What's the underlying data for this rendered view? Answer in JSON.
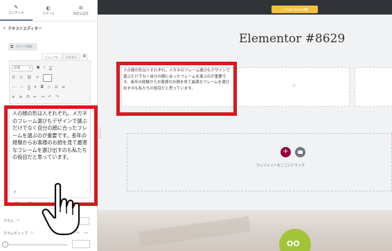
{
  "panel": {
    "tabs": [
      {
        "icon": "✎",
        "label": "コンテンツ"
      },
      {
        "icon": "◐",
        "label": "スタイル"
      },
      {
        "icon": "✲",
        "label": "高度な設定"
      }
    ],
    "section_title": "テキストエディター",
    "media_button": "メディアを追加",
    "editor_tabs": [
      "ビジュアル",
      "テキスト"
    ],
    "format_select": "段落",
    "toolbar_row1": [
      "B",
      "I",
      "U"
    ],
    "toolbar_row2": [
      "☰",
      "☷",
      "⛓",
      "✕"
    ],
    "toolbar_row3": [
      "—",
      "—",
      "A",
      "▾",
      "◘",
      "◇",
      "Ω",
      "≡"
    ],
    "toolbar_row4": [
      "≡",
      "≡",
      "Ω",
      "⇤",
      "⇥",
      "↶",
      "↷"
    ],
    "toolbar_row5": [
      "?"
    ],
    "editor_text": "人の顔の形は人それぞれ。メガネのフレーム選びもデザインで選ぶだけでなく自分の顔に合ったフレームを選ぶのが重要です。長年の経験からお客様のお顔を見て最適なフレームを選び出すのも私たちの役目だと思っています。",
    "path_tag": "P",
    "drop_cap_label": "ドロップキャップ",
    "columns_label": "カラム",
    "column_gap_label": "カラムギャップ",
    "unit_px": "PX",
    "unit_em": "EM",
    "unit_vw": "VW"
  },
  "topbar": {
    "button_label": "✓ Single Pageを編集"
  },
  "canvas": {
    "page_title": "Elementor #8629",
    "widget_text": "人の顔の形は人それぞれ。メガネのフレーム選びもデザインで選ぶだけでなく自分の顔に合ったフレームを選ぶのが重要です。長年の経験からお客様のお顔を見て最適なフレームを選び出すのも私たちの役目だと思っています。",
    "add_icon": "+",
    "add_column_icon": "+",
    "drag_hint": "ウィジェットをここにドラッグ",
    "logo_glyph": "OO"
  },
  "colors": {
    "highlight": "#d71920",
    "add_button": "#93003c",
    "topbar_bg": "#303438",
    "accent_yellow": "#f5c03c",
    "logo_green": "#a3c33a"
  }
}
